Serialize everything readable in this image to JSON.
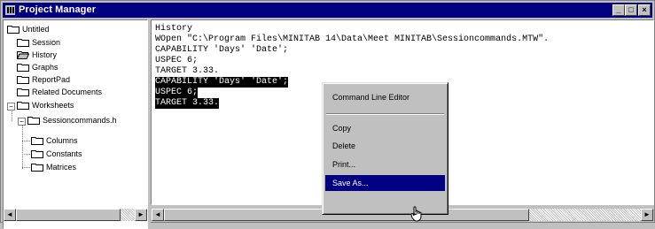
{
  "window": {
    "title": "Project Manager",
    "controls": {
      "minimize": "_",
      "maximize": "□",
      "close": "×"
    }
  },
  "tree": {
    "items": [
      {
        "label": "Untitled",
        "icon": "folder-icon"
      },
      {
        "label": "Session",
        "icon": "folder-icon"
      },
      {
        "label": "History",
        "icon": "folder-open-icon"
      },
      {
        "label": "Graphs",
        "icon": "folder-icon"
      },
      {
        "label": "ReportPad",
        "icon": "folder-icon"
      },
      {
        "label": "Related Documents",
        "icon": "folder-icon"
      },
      {
        "label": "Worksheets",
        "icon": "folder-icon",
        "expander": "−"
      },
      {
        "label": "Sessioncommands.h",
        "icon": "folder-icon",
        "expander": "−"
      },
      {
        "label": "Columns",
        "icon": "folder-icon"
      },
      {
        "label": "Constants",
        "icon": "folder-icon"
      },
      {
        "label": "Matrices",
        "icon": "folder-icon"
      }
    ]
  },
  "history": {
    "lines": [
      "History",
      "WOpen \"C:\\Program Files\\MINITAB 14\\Data\\Meet MINITAB\\Sessioncommands.MTW\".",
      "CAPABILITY 'Days' 'Date';",
      "USPEC 6;",
      "TARGET 3.33.",
      "CAPABILITY 'Days' 'Date';",
      "USPEC 6;",
      "TARGET 3.33."
    ],
    "selected_from": 5
  },
  "context_menu": {
    "items": [
      {
        "label": "Command Line Editor"
      },
      {
        "label": "Copy"
      },
      {
        "label": "Delete"
      },
      {
        "label": "Print..."
      },
      {
        "label": "Save As..."
      }
    ],
    "active_item": "Save As..."
  },
  "scrollbar": {
    "left": "◄",
    "right": "►"
  },
  "colors": {
    "titlebar": "#000080",
    "selection": "#000000",
    "menu_highlight": "#000080"
  }
}
